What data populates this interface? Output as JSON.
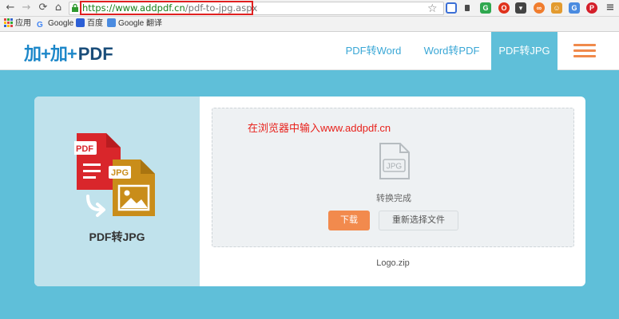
{
  "browser": {
    "url_host": "https://www.addpdf.cn",
    "url_path": "/pdf-to-jpg.aspx",
    "nav_icons": [
      "back-icon",
      "forward-icon",
      "reload-icon",
      "home-icon"
    ],
    "bookmarks": [
      {
        "label": "应用",
        "icon": "apps-grid-icon"
      },
      {
        "label": "Google",
        "icon": "google-icon"
      },
      {
        "label": "百度",
        "icon": "baidu-icon"
      },
      {
        "label": "Google 翻译",
        "icon": "google-translate-icon"
      }
    ]
  },
  "site": {
    "logo_cn": "加+加+",
    "logo_en": "PDF",
    "nav": [
      {
        "label": "PDF转Word",
        "active": false
      },
      {
        "label": "Word转PDF",
        "active": false
      },
      {
        "label": "PDF转JPG",
        "active": true
      }
    ]
  },
  "tool": {
    "title": "PDF转JPG",
    "icon_badge_pdf": "PDF",
    "icon_badge_jpg": "JPG",
    "instruction": "在浏览器中输入www.addpdf.cn",
    "result_icon_label": "JPG",
    "status": "转换完成",
    "download_label": "下载",
    "reselect_label": "重新选择文件",
    "filename": "Logo.zip"
  },
  "colors": {
    "page_bg": "#5fbfd9",
    "accent_orange": "#f28a4d",
    "link_blue": "#3aa7d6",
    "annotation_red": "#e8221c"
  }
}
